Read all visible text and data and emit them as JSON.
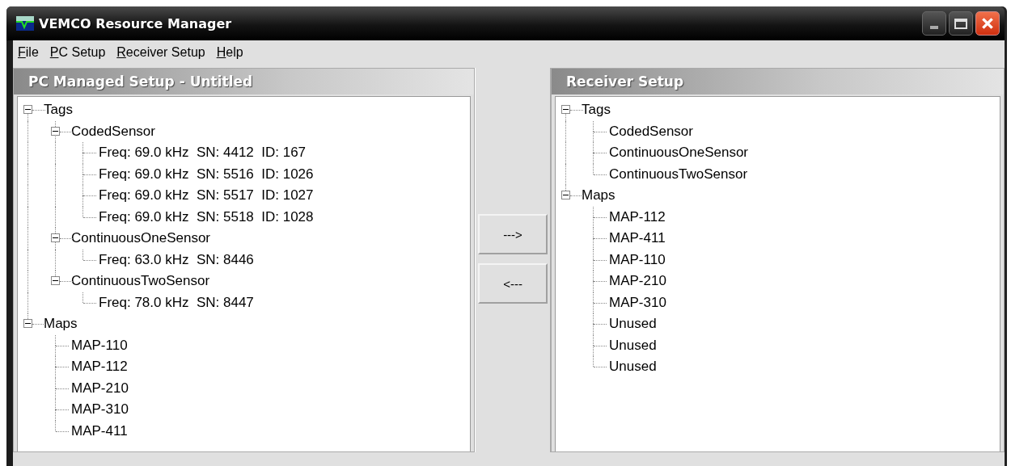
{
  "window": {
    "title": "VEMCO Resource Manager"
  },
  "menu": [
    "File",
    "PC Setup",
    "Receiver Setup",
    "Help"
  ],
  "left_panel": {
    "title": "PC Managed Setup - Untitled",
    "tree": [
      {
        "label": "Tags",
        "expanded": true,
        "children": [
          {
            "label": "CodedSensor",
            "expanded": true,
            "children": [
              {
                "label": "Freq: 69.0 kHz  SN: 4412  ID: 167"
              },
              {
                "label": "Freq: 69.0 kHz  SN: 5516  ID: 1026"
              },
              {
                "label": "Freq: 69.0 kHz  SN: 5517  ID: 1027"
              },
              {
                "label": "Freq: 69.0 kHz  SN: 5518  ID: 1028"
              }
            ]
          },
          {
            "label": "ContinuousOneSensor",
            "expanded": true,
            "children": [
              {
                "label": "Freq: 63.0 kHz  SN: 8446"
              }
            ]
          },
          {
            "label": "ContinuousTwoSensor",
            "expanded": true,
            "children": [
              {
                "label": "Freq: 78.0 kHz  SN: 8447"
              }
            ]
          }
        ]
      },
      {
        "label": "Maps",
        "expanded": true,
        "children": [
          {
            "label": "MAP-110"
          },
          {
            "label": "MAP-112"
          },
          {
            "label": "MAP-210"
          },
          {
            "label": "MAP-310"
          },
          {
            "label": "MAP-411"
          }
        ]
      }
    ]
  },
  "transfer_buttons": [
    "--->",
    "<---"
  ],
  "right_panel": {
    "title": "Receiver Setup",
    "tree": [
      {
        "label": "Tags",
        "expanded": true,
        "children": [
          {
            "label": "CodedSensor"
          },
          {
            "label": "ContinuousOneSensor"
          },
          {
            "label": "ContinuousTwoSensor"
          }
        ]
      },
      {
        "label": "Maps",
        "expanded": true,
        "children": [
          {
            "label": "MAP-112"
          },
          {
            "label": "MAP-411"
          },
          {
            "label": "MAP-110"
          },
          {
            "label": "MAP-210"
          },
          {
            "label": "MAP-310"
          },
          {
            "label": "Unused"
          },
          {
            "label": "Unused"
          },
          {
            "label": "Unused"
          }
        ]
      }
    ]
  }
}
